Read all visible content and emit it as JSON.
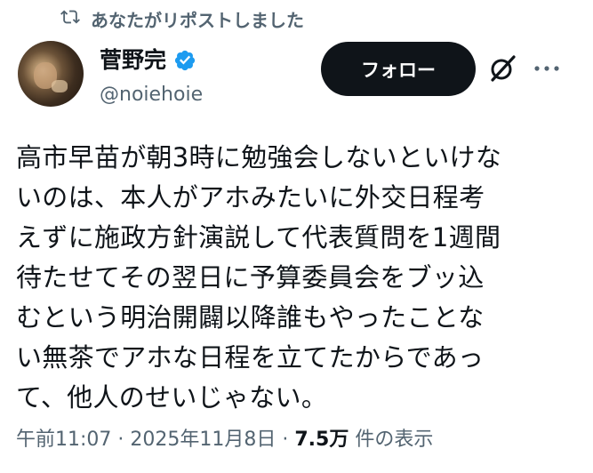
{
  "repost": {
    "icon": "repost-icon",
    "text": "あなたがリポストしました"
  },
  "author": {
    "avatar": "avatar",
    "name": "菅野完",
    "verified_icon": "verified-badge-icon",
    "handle": "@noiehoie"
  },
  "actions": {
    "follow_label": "フォロー",
    "grok_icon": "grok-icon",
    "more_icon": "more-icon"
  },
  "post": {
    "text": "高市早苗が朝3時に勉強会しないといけな\nいのは、本人がアホみたいに外交日程考\nえずに施政方針演説して代表質問を1週間\n待たせてその翌日に予算委員会をブッ込\nむという明治開闢以降誰もやったことな\nい無茶でアホな日程を立てたからであっ\nて、他人のせいじゃない。"
  },
  "meta": {
    "time": "午前11:07",
    "sep1": " · ",
    "date": "2025年11月8日",
    "sep2": " · ",
    "views_count": "7.5万",
    "views_label": " 件の表示"
  },
  "colors": {
    "text": "#0f1419",
    "secondary": "#536471",
    "verified": "#1d9bf0",
    "button": "#0f1419"
  }
}
